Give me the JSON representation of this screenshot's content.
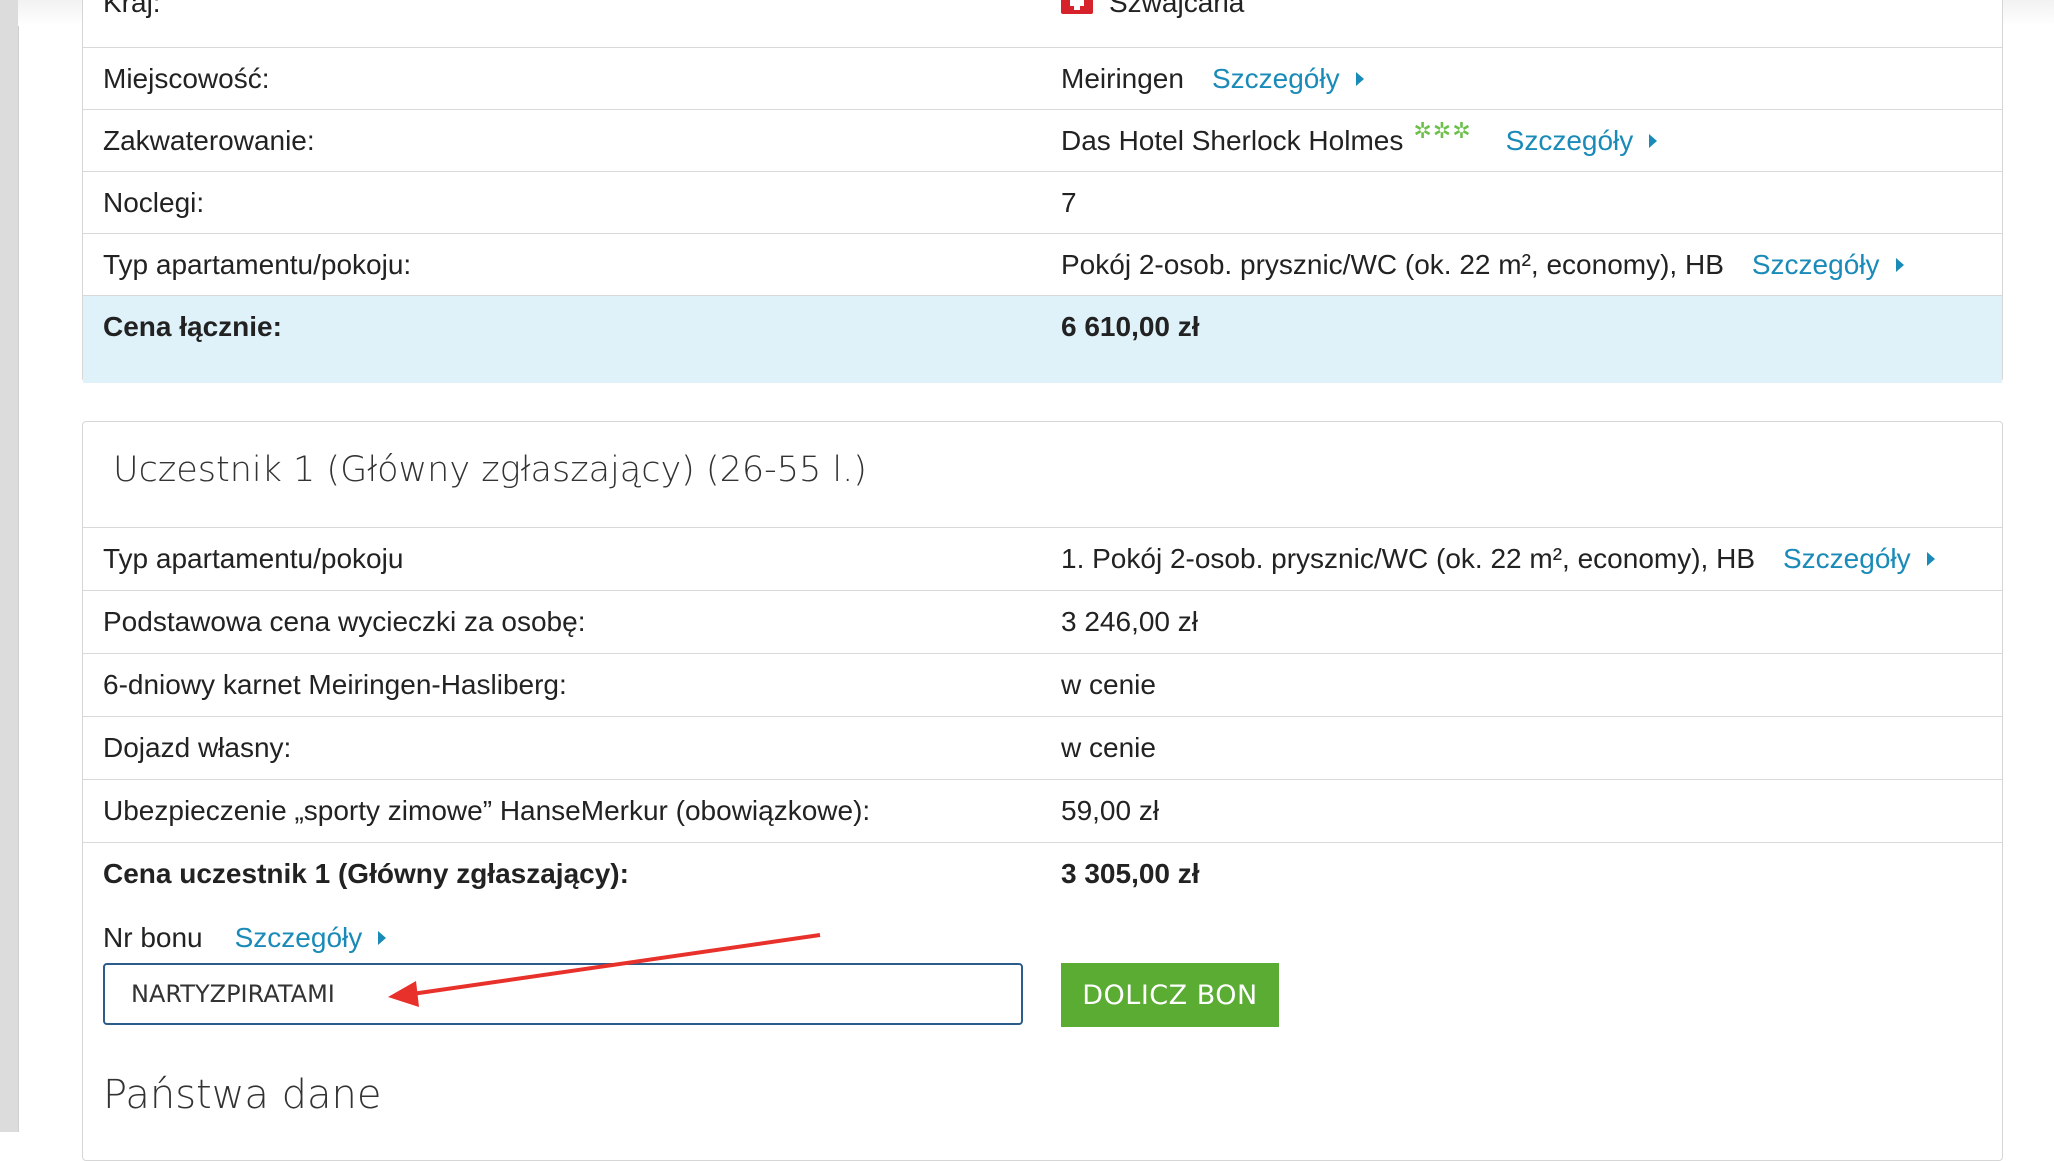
{
  "trip": {
    "rows": [
      {
        "label": "Kraj:",
        "value": "Szwajcaria",
        "flag": "switzerland-flag"
      },
      {
        "label": "Miejscowość:",
        "value": "Meiringen",
        "link": "Szczegóły"
      },
      {
        "label": "Zakwaterowanie:",
        "value": "Das Hotel Sherlock Holmes",
        "stars": "***",
        "link": "Szczegóły"
      },
      {
        "label": "Noclegi:",
        "value": "7"
      },
      {
        "label": "Typ apartamentu/pokoju:",
        "value": "Pokój 2-osob. prysznic/WC (ok. 22 m², economy), HB",
        "link": "Szczegóły"
      },
      {
        "label": "Cena łącznie:",
        "value": "6 610,00 zł"
      }
    ]
  },
  "participant": {
    "heading": "Uczestnik 1 (Główny zgłaszający) (26-55 l.)",
    "rows": [
      {
        "label": "Typ apartamentu/pokoju",
        "value": "1. Pokój 2-osob. prysznic/WC (ok. 22 m², economy), HB",
        "link": "Szczegóły"
      },
      {
        "label": "Podstawowa cena wycieczki za osobę:",
        "value": "3 246,00 zł"
      },
      {
        "label": "6-dniowy karnet Meiringen-Hasliberg:",
        "value": "w cenie"
      },
      {
        "label": "Dojazd własny:",
        "value": "w cenie"
      },
      {
        "label": "Ubezpieczenie „sporty zimowe” HanseMerkur (obowiązkowe):",
        "value": "59,00 zł"
      },
      {
        "label": "Cena uczestnik 1 (Główny zgłaszający):",
        "value": "3 305,00 zł"
      }
    ]
  },
  "voucher": {
    "label": "Nr bonu",
    "link": "Szczegóły",
    "value": "NARTYZPIRATAMI",
    "button": "DOLICZ BON"
  },
  "section_title": "Państwa dane",
  "colors": {
    "link": "#1a8bb8",
    "total_row_bg": "#dff2f9",
    "button_bg": "#5aac32",
    "stars": "#6cc04a",
    "annotation_arrow": "#e8312a"
  }
}
